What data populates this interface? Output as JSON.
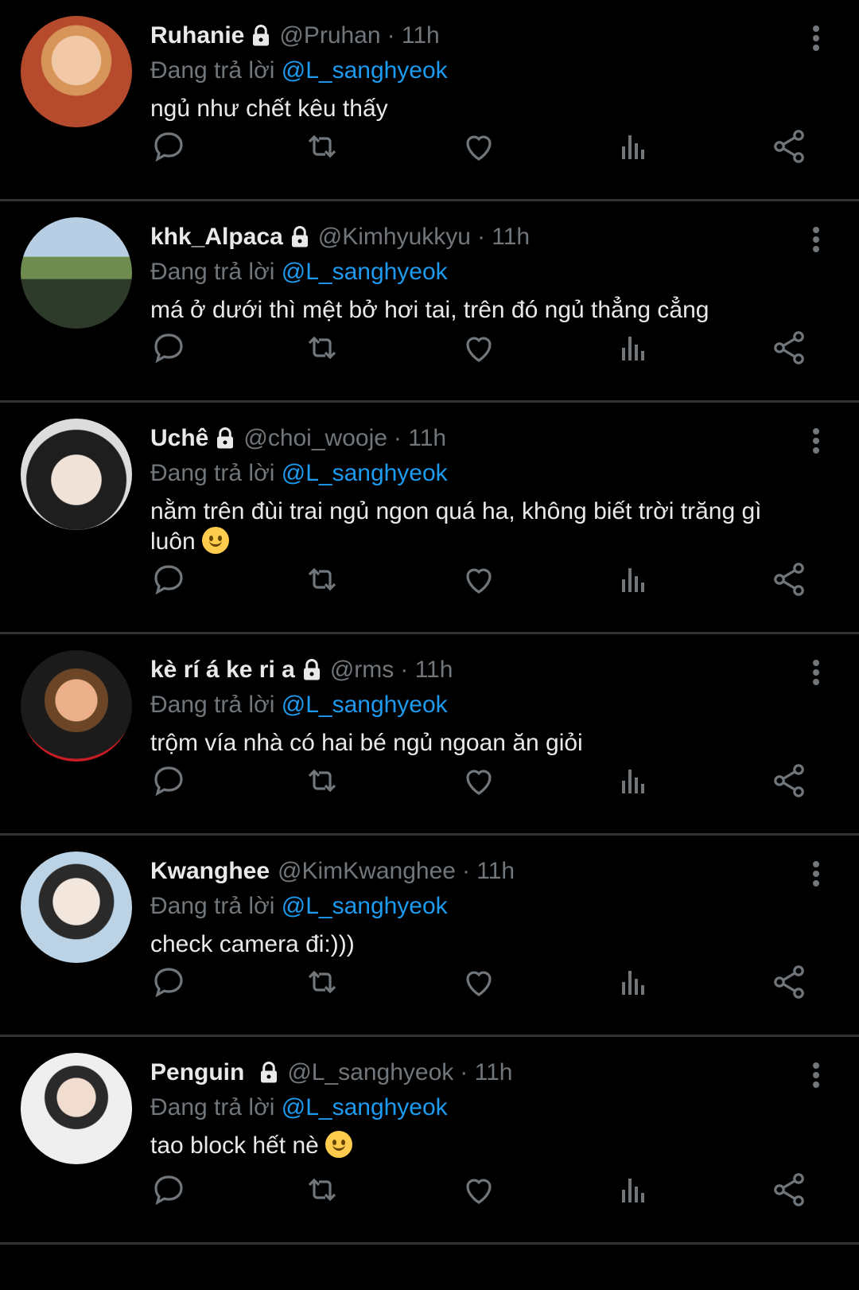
{
  "reply_prefix": "Đang trả lời",
  "reply_to": "@L_sanghyeok",
  "tweets": [
    {
      "name": "Ruhanie",
      "handle": "@Pruhan",
      "time": "· 11h",
      "text": "ngủ như chết kêu thấy",
      "emoji": ""
    },
    {
      "name": "khk_Alpaca",
      "handle": "@Kimhyukkyu",
      "time": "· 11h",
      "text": "má ở dưới thì mệt bở hơi tai, trên đó ngủ thẳng cẳng",
      "emoji": ""
    },
    {
      "name": "Uchê",
      "handle": "@choi_wooje",
      "time": "· 11h",
      "text": "nằm trên đùi trai ngủ ngon quá ha, không biết trời trăng gì luôn",
      "emoji": "smiling-face"
    },
    {
      "name": "kè rí á ke ri a",
      "handle": "@rms",
      "time": "· 11h",
      "text": "trộm vía nhà có hai bé ngủ ngoan ăn giỏi",
      "emoji": ""
    },
    {
      "name": "Kwanghee",
      "handle": "@KimKwanghee",
      "time": "· 11h",
      "text": "check camera đi:)))",
      "emoji": ""
    },
    {
      "name": "Penguin",
      "handle": "@L_sanghyeok",
      "time": "· 11h",
      "text": "tao block hết nè",
      "emoji": "slightly-smiling-face"
    }
  ],
  "icons": [
    "reply-icon",
    "retweet-icon",
    "like-icon",
    "views-icon",
    "share-icon",
    "more-icon",
    "lock-icon"
  ],
  "colors": {
    "background": "#000000",
    "link": "#1d9bf0",
    "muted": "#71767b",
    "divider": "#2f3336"
  }
}
